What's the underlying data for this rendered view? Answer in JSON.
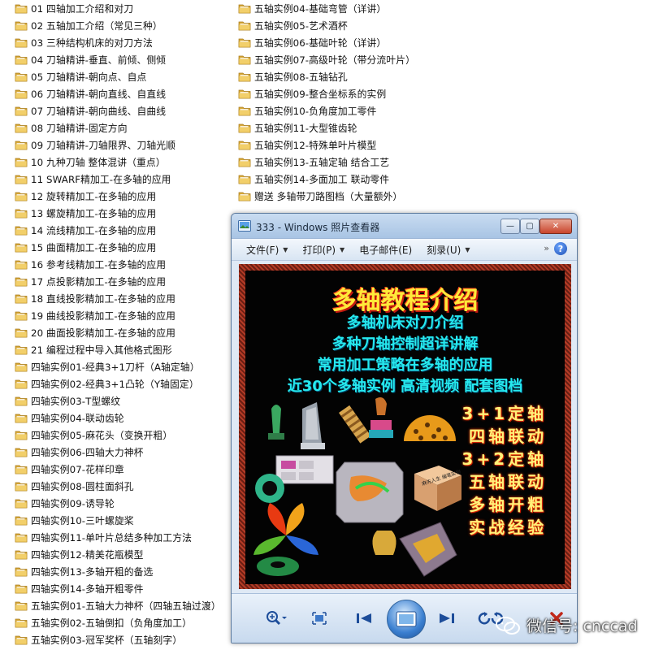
{
  "folders_left": [
    "01 四轴加工介绍和对刀",
    "02 五轴加工介绍（常见三种）",
    "03 三种结构机床的对刀方法",
    "04 刀轴精讲-垂直、前倾、侧倾",
    "05 刀轴精讲-朝向点、自点",
    "06 刀轴精讲-朝向直线、自直线",
    "07 刀轴精讲-朝向曲线、自曲线",
    "08 刀轴精讲-固定方向",
    "09 刀轴精讲-刀轴限界、刀轴光顺",
    "10 九种刀轴 整体混讲（重点）",
    "11 SWARF精加工-在多轴的应用",
    "12 旋转精加工-在多轴的应用",
    "13 螺旋精加工-在多轴的应用",
    "14 流线精加工-在多轴的应用",
    "15 曲面精加工-在多轴的应用",
    "16 参考线精加工-在多轴的应用",
    "17 点投影精加工-在多轴的应用",
    "18 直线投影精加工-在多轴的应用",
    "19 曲线投影精加工-在多轴的应用",
    "20 曲面投影精加工-在多轴的应用",
    "21 编程过程中导入其他格式图形",
    "四轴实例01-经典3+1刀杆（A轴定轴）",
    "四轴实例02-经典3+1凸轮（Y轴固定）",
    "四轴实例03-T型螺纹",
    "四轴实例04-联动齿轮",
    "四轴实例05-麻花头（变换开粗）",
    "四轴实例06-四轴大力神杯",
    "四轴实例07-花样印章",
    "四轴实例08-圆柱面斜孔",
    "四轴实例09-诱导轮",
    "四轴实例10-三叶螺旋桨",
    "四轴实例11-单叶片总结多种加工方法",
    "四轴实例12-精美花瓶模型",
    "四轴实例13-多轴开粗的备选",
    "四轴实例14-多轴开粗零件",
    "五轴实例01-五轴大力神杯（四轴五轴过渡）",
    "五轴实例02-五轴倒扣（负角度加工）",
    "五轴实例03-冠军奖杯（五轴刻字）"
  ],
  "folders_right": [
    "五轴实例04-基础弯管（详讲）",
    "五轴实例05-艺术酒杯",
    "五轴实例06-基础叶轮（详讲）",
    "五轴实例07-高级叶轮（带分流叶片）",
    "五轴实例08-五轴钻孔",
    "五轴实例09-整合坐标系的实例",
    "五轴实例10-负角度加工零件",
    "五轴实例11-大型锥齿轮",
    "五轴实例12-特殊单叶片模型",
    "五轴实例13-五轴定轴 结合工艺",
    "五轴实例14-多面加工 联动零件",
    "赠送 多轴带刀路图档（大量额外）"
  ],
  "viewer": {
    "title": "333 - Windows 照片查看器",
    "menu": {
      "file": "文件(F)",
      "print": "打印(P)",
      "email": "电子邮件(E)",
      "burn": "刻录(U)",
      "more": "»"
    },
    "help": "?",
    "controls": {
      "minimize": "—",
      "maximize": "▢",
      "close": "✕"
    }
  },
  "poster": {
    "title": "多轴教程介绍",
    "lines": [
      "多轴机床对刀介绍",
      "多种刀轴控制超详讲解",
      "常用加工策略在多轴的应用",
      "近30个多轴实例 高清视频 配套图档"
    ],
    "features": [
      "3+1定轴",
      "四轴联动",
      "3+2定轴",
      "五轴联动",
      "多轴开粗",
      "实战经验"
    ],
    "seal_text": "麻先人生 编笔实物"
  },
  "watermark": "微信号: cnccad",
  "colors": {
    "folder": "#e8c25a",
    "poster_title": "#ffe93a",
    "poster_lines": "#26e9ee",
    "poster_features": "#fff27a"
  }
}
